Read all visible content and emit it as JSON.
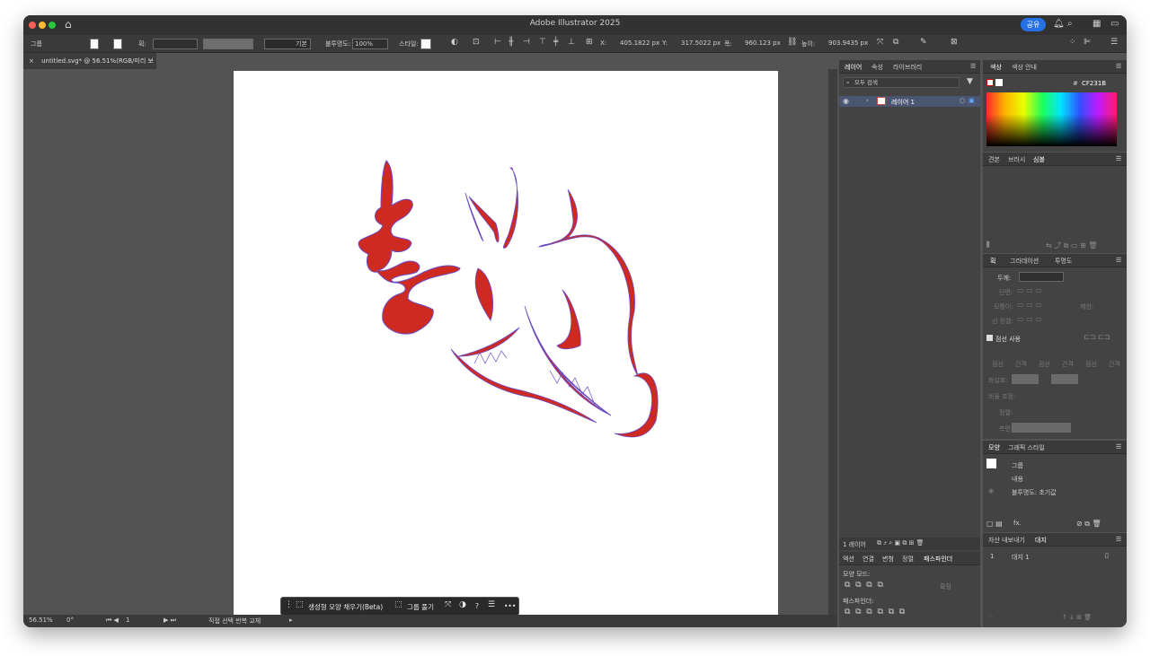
{
  "app": {
    "title": "Adobe Illustrator 2025",
    "share": "공유"
  },
  "control": {
    "selection": "그룹",
    "stroke_label": "획:",
    "stroke_style": "기본",
    "opacity_label": "불투명도:",
    "opacity": "100%",
    "style_label": "스타일:",
    "x_label": "X:",
    "x": "405.1822 px",
    "y_label": "Y:",
    "y": "317.5022 px",
    "w_label": "폭:",
    "w": "960.123 px",
    "h_label": "높이:",
    "h": "903.9435 px"
  },
  "doc_tab": {
    "close": "×",
    "title": "untitled.svg* @ 56.51%(RGB/미리 보기)"
  },
  "status": {
    "zoom": "56.51%",
    "rotation": "0°",
    "artboard": "1",
    "tool": "직접 선택 반복 교체"
  },
  "context_bar": {
    "gen_fill": "생성형 모양 채우기(Beta)",
    "ungroup": "그룹 풀기",
    "help": "?",
    "more": "•••"
  },
  "layers": {
    "tabs": [
      "레이어",
      "속성",
      "라이브러리"
    ],
    "search": "모두 검색",
    "layer_name": "레이어 1",
    "count": "1 레이어"
  },
  "pathfinder": {
    "tabs": [
      "액션",
      "연결",
      "변형",
      "정렬",
      "패스파인더"
    ],
    "shape_modes": "모양 모드:",
    "expand": "확장",
    "pathfinders": "패스파인더:"
  },
  "color": {
    "tabs": [
      "색상",
      "색상 안내"
    ],
    "hex_prefix": "#",
    "hex": "CF231B",
    "swatch": "#CF231B"
  },
  "swatches": {
    "tabs": [
      "견본",
      "브러시",
      "심볼"
    ]
  },
  "stroke_panel": {
    "tabs": [
      "획",
      "그라데이션",
      "투명도"
    ],
    "weight": "두께:",
    "cap": "단면:",
    "corner": "모퉁이:",
    "limit": "제한:",
    "align": "선 정렬:",
    "dashed": "점선 사용",
    "dash": [
      "점선",
      "간격",
      "점선",
      "간격",
      "점선",
      "간격"
    ],
    "arrow": "화살표:",
    "scale": "비율 조정:",
    "align2": "정렬:",
    "profile": "측면:"
  },
  "appearance": {
    "tabs": [
      "모양",
      "그래픽 스타일"
    ],
    "group": "그룹",
    "contents": "내용",
    "opacity": "불투명도: 초기값",
    "fx": "fx."
  },
  "export": {
    "tabs": [
      "자산 내보내기",
      "대지"
    ],
    "row_num": "1",
    "row_name": "대지 1"
  }
}
